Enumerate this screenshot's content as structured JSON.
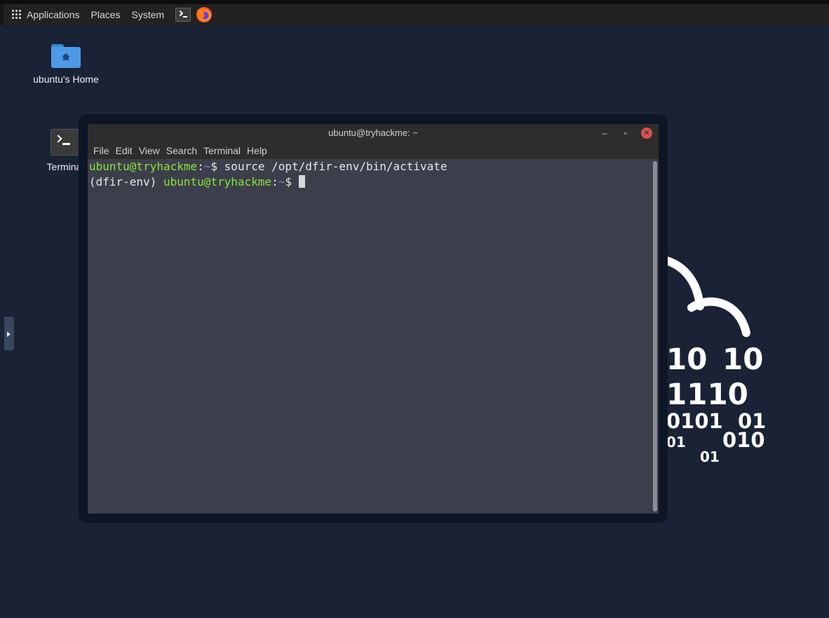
{
  "panel": {
    "applications": "Applications",
    "places": "Places",
    "system": "System"
  },
  "desktop": {
    "home_label": "ubuntu's Home",
    "terminal_label": "Terminal"
  },
  "wallpaper": {
    "bits": [
      "10",
      "10",
      "1110",
      "0101",
      "01",
      "01",
      "010",
      "01"
    ]
  },
  "window": {
    "title": "ubuntu@tryhackme: ~",
    "minimize": "–",
    "maximize": "▫",
    "close": "✕",
    "menu": [
      "File",
      "Edit",
      "View",
      "Search",
      "Terminal",
      "Help"
    ]
  },
  "terminal": {
    "line1": {
      "user": "ubuntu@tryhackme",
      "colon": ":",
      "dir": "~",
      "prompt": "$ ",
      "command": "source /opt/dfir-env/bin/activate"
    },
    "line2": {
      "env": "(dfir-env) ",
      "user": "ubuntu@tryhackme",
      "colon": ":",
      "dir": "~",
      "prompt": "$ "
    }
  }
}
